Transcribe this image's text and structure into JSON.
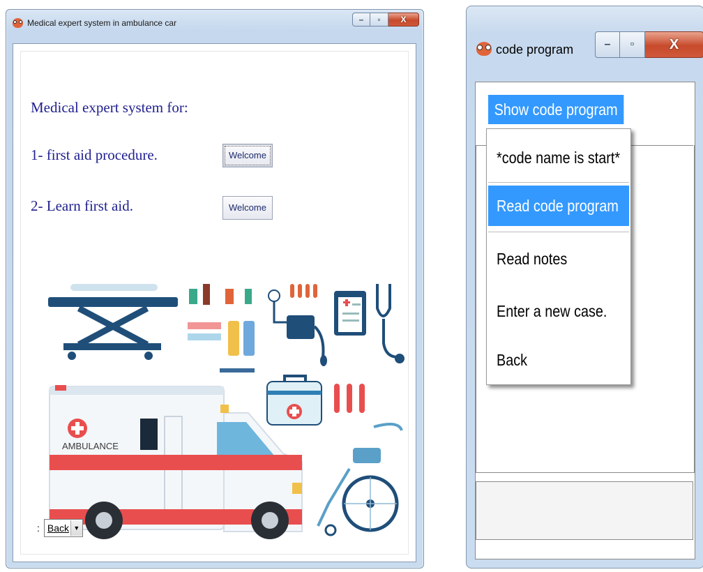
{
  "window_main": {
    "title": "Medical expert system in ambulance car",
    "controls": {
      "minimize": "–",
      "maximize": "▫",
      "close": "X"
    },
    "heading": "Medical expert system for:",
    "items": [
      {
        "label": "1- first aid procedure.",
        "button": "Welcome"
      },
      {
        "label": "2- Learn first aid.",
        "button": "Welcome"
      }
    ],
    "back_select": {
      "prefix": ":",
      "value": "Back",
      "arrow": "▼"
    },
    "illustration": {
      "ambulance_text": "AMBULANCE"
    }
  },
  "window_code": {
    "title": "code program",
    "controls": {
      "minimize": "–",
      "maximize": "▫",
      "close": "X"
    },
    "menubar": {
      "active_item": "Show code program"
    },
    "dropdown_items": [
      "*code name is start*",
      "Read code  program",
      "Read notes",
      "Enter a new case.",
      "Back"
    ],
    "highlighted_index": 1
  },
  "colors": {
    "selection": "#3399ff",
    "text_blue": "#1f1f8f",
    "ambulance_red": "#e94e4e",
    "stretcher_blue": "#1f4e79"
  }
}
